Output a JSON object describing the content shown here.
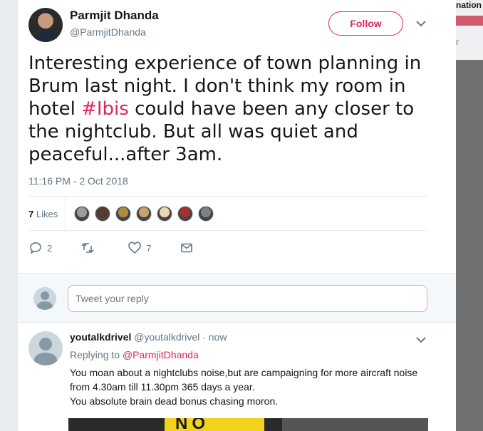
{
  "side_panel": {
    "title_fragment": "nation",
    "letter": "r"
  },
  "tweet": {
    "author_name": "Parmjit Dhanda",
    "author_handle": "@ParmjitDhanda",
    "follow_label": "Follow",
    "text_before": "Interesting experience of town planning in Brum last night. I don't think my room in hotel ",
    "hashtag": "#Ibis",
    "text_after": " could have been any closer to the nightclub. But all was quiet and peaceful...after 3am.",
    "timestamp": "11:16 PM - 2 Oct 2018",
    "likes_count": "7",
    "likes_label": "Likes",
    "likers": [
      {
        "icon": "liker-avatar-1",
        "color": "#9c9c9c"
      },
      {
        "icon": "liker-avatar-2",
        "color": "#5a3a2a"
      },
      {
        "icon": "liker-avatar-3",
        "color": "#b08a40"
      },
      {
        "icon": "liker-avatar-4",
        "color": "#caa070"
      },
      {
        "icon": "liker-avatar-5",
        "color": "#e8d8b0"
      },
      {
        "icon": "liker-avatar-6",
        "color": "#a83030"
      },
      {
        "icon": "liker-avatar-7",
        "color": "#7a7f88"
      }
    ],
    "replies_count": "2",
    "retweets_count": "",
    "likes_action_count": "7"
  },
  "reply_box": {
    "placeholder": "Tweet your reply"
  },
  "reply": {
    "name": "youtalkdrivel",
    "handle": "@youtalkdrivel",
    "dot": "·",
    "time": "now",
    "replying_prefix": "Replying to",
    "replying_to": "@ParmjitDhanda",
    "lines": [
      "You moan about a nightclubs noise,but are campaigning for more aircraft noise from 4.30am till 11.30pm 365 days a year.",
      "You absolute brain dead bonus chasing moron."
    ],
    "media_text": "NO"
  },
  "colors": {
    "accent": "#e0245e",
    "muted": "#657786",
    "background": "#e6ecf0"
  }
}
